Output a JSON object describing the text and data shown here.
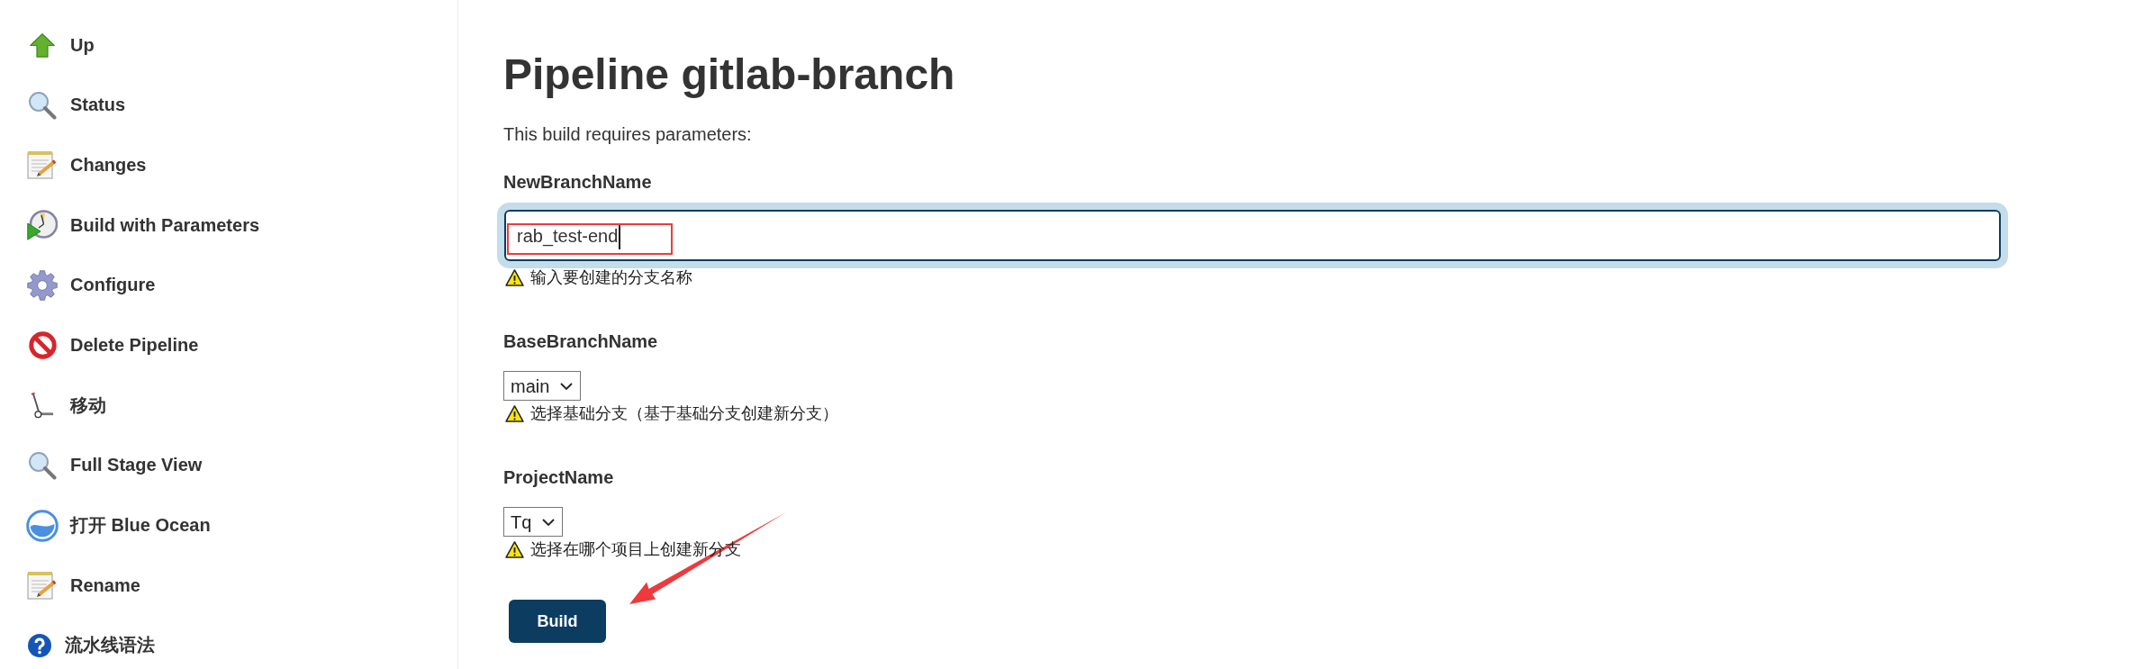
{
  "sidebar": {
    "items": [
      {
        "label": "Up",
        "kind": "up"
      },
      {
        "label": "Status",
        "kind": "status"
      },
      {
        "label": "Changes",
        "kind": "changes"
      },
      {
        "label": "Build with Parameters",
        "kind": "build"
      },
      {
        "label": "Configure",
        "kind": "configure"
      },
      {
        "label": "Delete Pipeline",
        "kind": "delete"
      },
      {
        "label": "移动",
        "kind": "move"
      },
      {
        "label": "Full Stage View",
        "kind": "stage-view"
      },
      {
        "label": "打开 Blue Ocean",
        "kind": "blue-ocean"
      },
      {
        "label": "Rename",
        "kind": "rename"
      },
      {
        "label": "流水线语法",
        "kind": "help"
      }
    ]
  },
  "page": {
    "title": "Pipeline gitlab-branch",
    "intro": "This build requires parameters:"
  },
  "parameters": [
    {
      "name": "NewBranchName",
      "kind": "text",
      "value": "rab_test-end",
      "focused": true,
      "highlighted": true,
      "hint": "输入要创建的分支名称"
    },
    {
      "name": "BaseBranchName",
      "kind": "choice",
      "value": "main",
      "hint": "选择基础分支（基于基础分支创建新分支）"
    },
    {
      "name": "ProjectName",
      "kind": "choice",
      "value": "Tq",
      "hint": "选择在哪个项目上创建新分支"
    }
  ],
  "build_button": {
    "label": "Build",
    "pointed_at": true
  }
}
